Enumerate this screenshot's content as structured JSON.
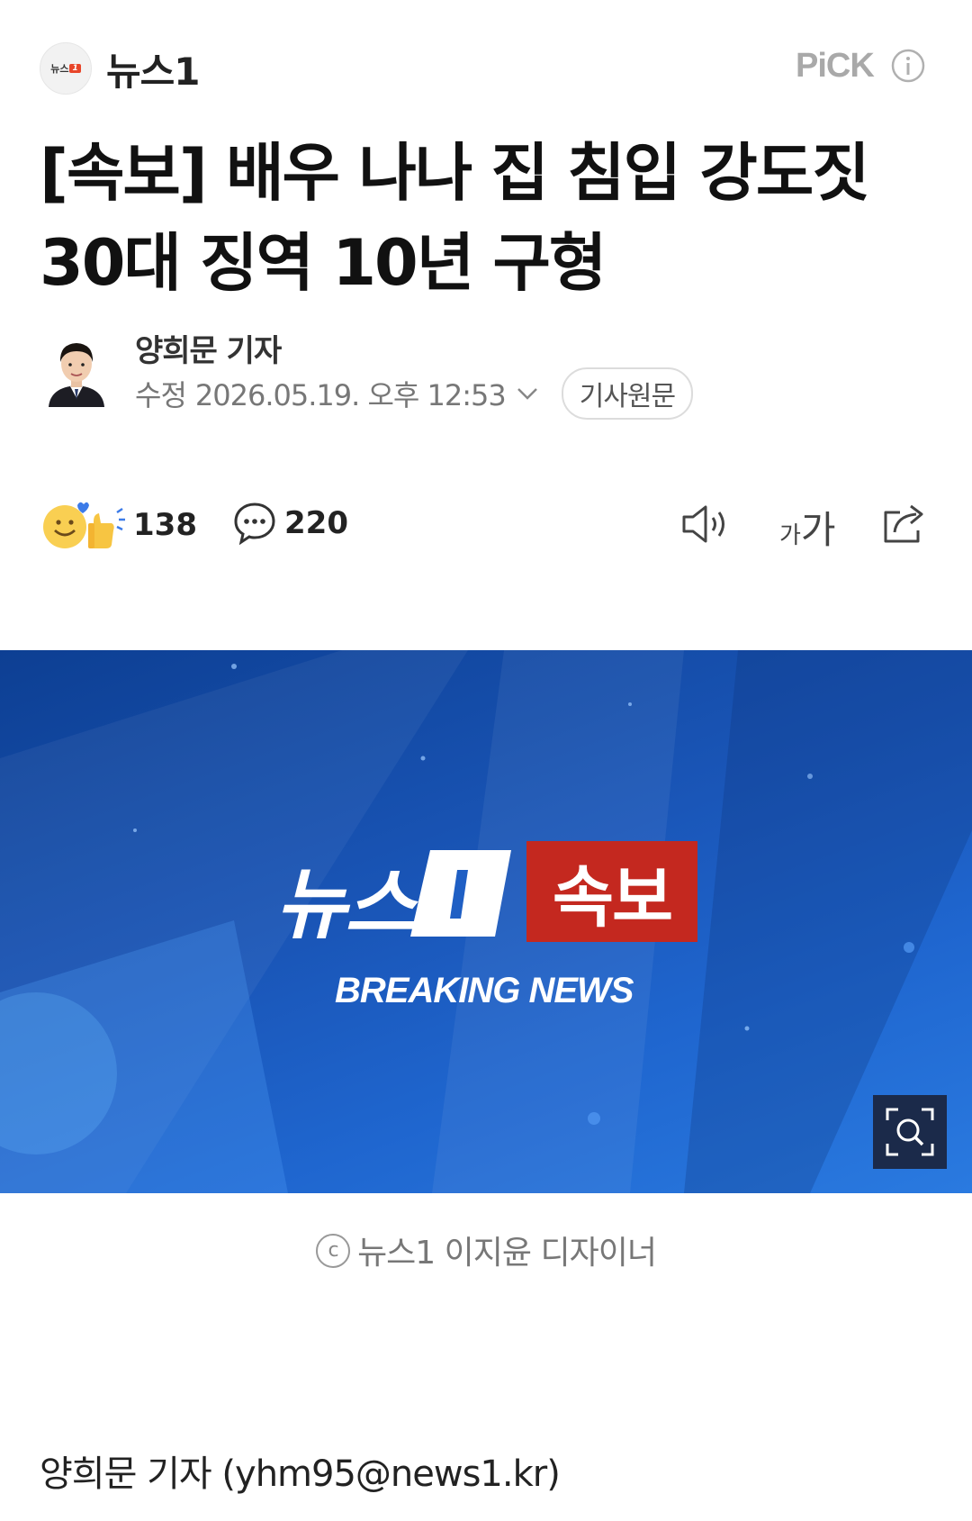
{
  "header": {
    "press_logo_text": "뉴스",
    "press_logo_mark": "1",
    "press_name": "뉴스1",
    "pick_label": "PiCK"
  },
  "article": {
    "title_line1": "[속보] 배우 나나 집 침입 강도짓",
    "title_line2": "30대 징역 10년 구형",
    "reporter": "양희문 기자",
    "timestamp_label": "수정",
    "timestamp_value": "2026.05.19. 오후 12:53",
    "original_button": "기사원문"
  },
  "actions": {
    "reaction_count": "138",
    "comment_count": "220",
    "fontsize_small": "가",
    "fontsize_big": "가"
  },
  "image": {
    "brand": "뉴스",
    "breaking_ko": "속보",
    "breaking_en": "BREAKING NEWS",
    "caption": "뉴스1 이지윤 디자이너",
    "copyright_symbol": "c"
  },
  "body": {
    "byline": "양희문 기자 (yhm95@news1.kr)"
  },
  "colors": {
    "breaking_red": "#c4281f",
    "hero_blue": "#1a56b8",
    "muted_text": "#777777"
  }
}
